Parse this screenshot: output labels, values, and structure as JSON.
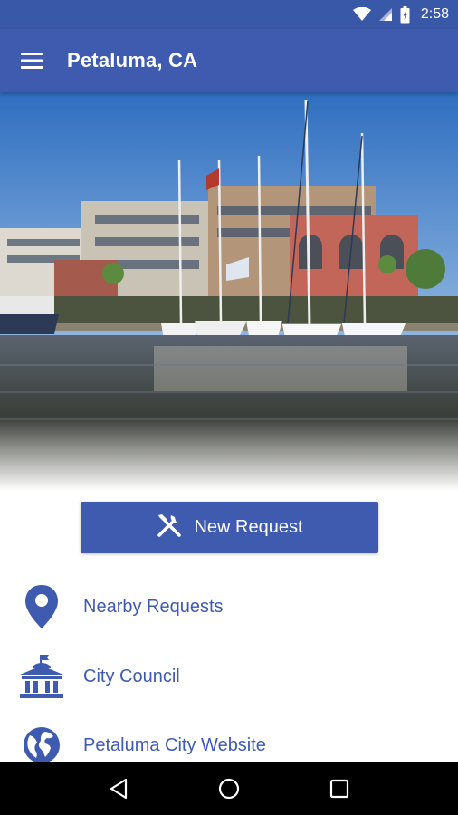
{
  "status_bar": {
    "time": "2:58",
    "icons": [
      "wifi-icon",
      "cell-signal-icon",
      "battery-icon"
    ]
  },
  "app_bar": {
    "menu_icon": "hamburger-menu-icon",
    "title": "Petaluma, CA"
  },
  "hero": {
    "description_icon": "hero-photo"
  },
  "new_request": {
    "label": "New Request",
    "icon": "tools-icon"
  },
  "menu_items": [
    {
      "label": "Nearby Requests",
      "icon": "map-pin-icon"
    },
    {
      "label": "City Council",
      "icon": "city-hall-icon"
    },
    {
      "label": "Petaluma City Website",
      "icon": "globe-icon"
    }
  ],
  "system_nav": {
    "icons": [
      "back-icon",
      "home-icon",
      "recents-icon"
    ]
  },
  "colors": {
    "primary": "#3f5bb0",
    "status_bar": "#3a58a8",
    "nav_bar": "#000000",
    "background": "#ffffff"
  }
}
